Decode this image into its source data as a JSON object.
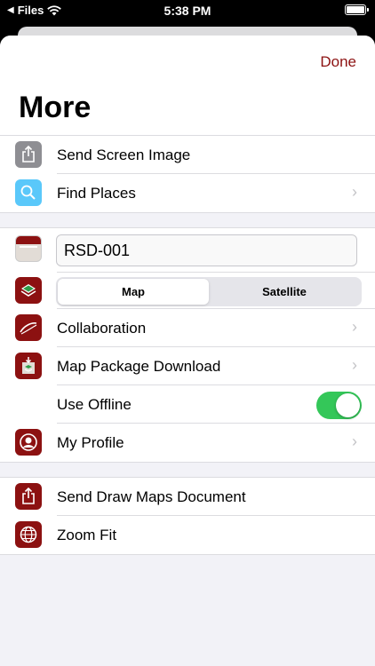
{
  "status_bar": {
    "back_app": "Files",
    "time": "5:38 PM"
  },
  "sheet": {
    "done_label": "Done",
    "title": "More"
  },
  "group1": {
    "send_screen_image": "Send Screen Image",
    "find_places": "Find Places"
  },
  "group2": {
    "map_name_value": "RSD-001",
    "map_type_options": [
      "Map",
      "Satellite"
    ],
    "map_type_selected": "Map",
    "collaboration": "Collaboration",
    "map_package_download": "Map Package Download",
    "use_offline": "Use Offline",
    "use_offline_on": true,
    "my_profile": "My Profile"
  },
  "group3": {
    "send_draw_maps_document": "Send Draw Maps Document",
    "zoom_fit": "Zoom Fit"
  },
  "colors": {
    "accent": "#8c1111",
    "toggle_on": "#34c759",
    "icon_gray": "#8e8e93",
    "icon_blue": "#5ac8fa"
  }
}
